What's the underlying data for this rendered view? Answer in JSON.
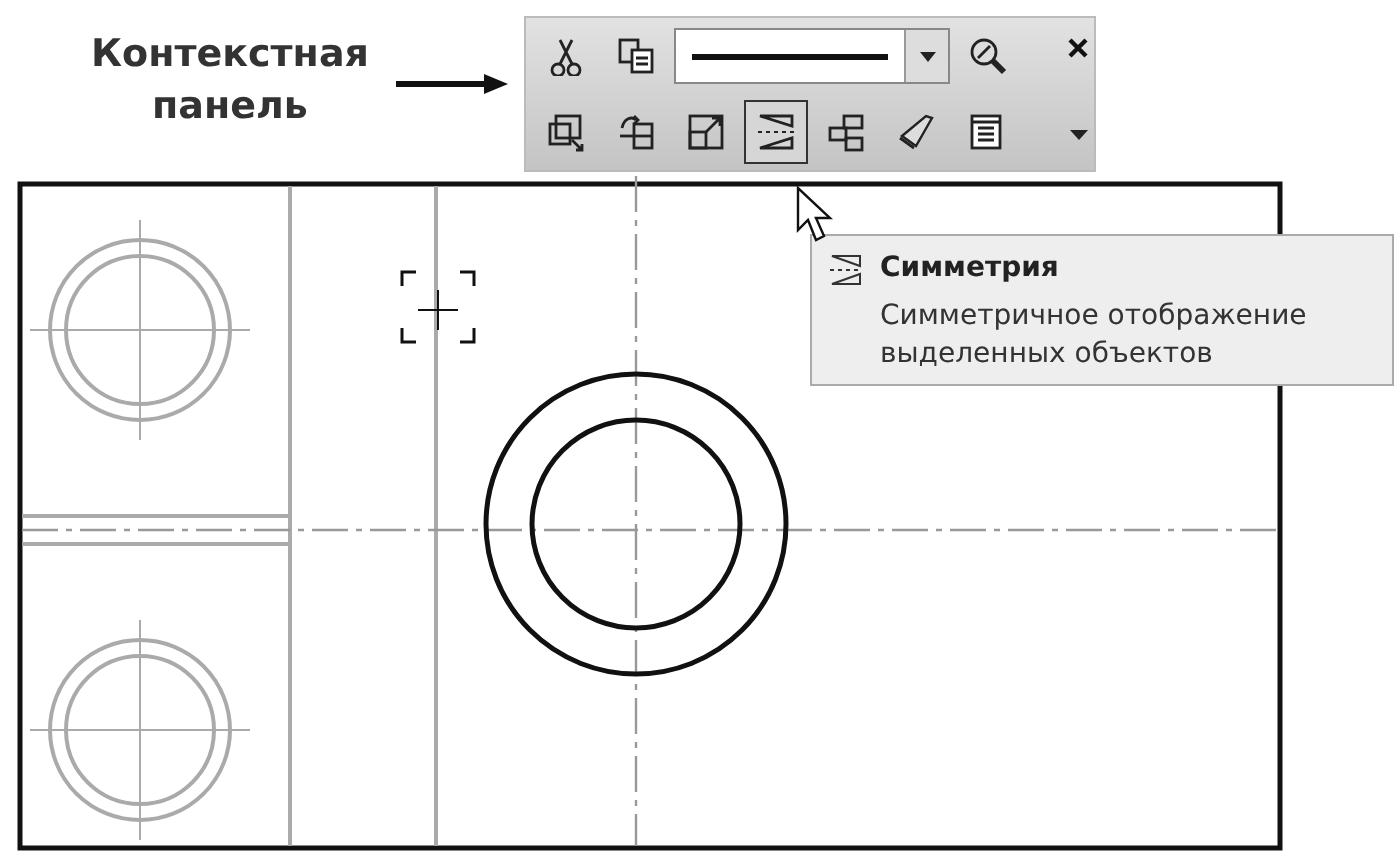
{
  "callout": {
    "label": "Контекстная панель"
  },
  "context_panel": {
    "rows": [
      [
        {
          "kind": "button",
          "selected": false
        },
        {
          "kind": "button",
          "selected": false
        },
        {
          "kind": "line-style",
          "selected": false
        },
        {
          "kind": "button",
          "selected": false
        }
      ],
      [
        {
          "kind": "button",
          "selected": false
        },
        {
          "kind": "button",
          "selected": false
        },
        {
          "kind": "button",
          "selected": false
        },
        {
          "kind": "button",
          "selected": true
        },
        {
          "kind": "button",
          "selected": false
        },
        {
          "kind": "button",
          "selected": false
        },
        {
          "kind": "button",
          "selected": false
        }
      ]
    ]
  },
  "tooltip": {
    "title": "Симметрия",
    "description": "Симметричное отображение выделенных объектов"
  }
}
